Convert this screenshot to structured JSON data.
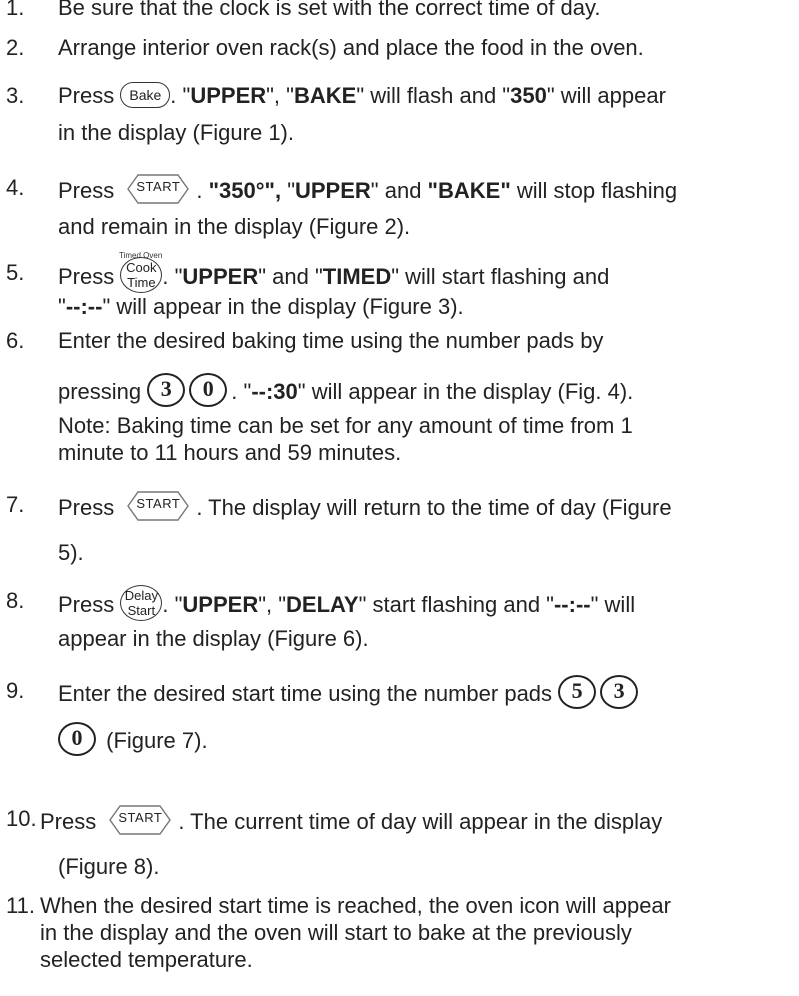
{
  "steps": {
    "s1": {
      "num": "1.",
      "text": "Be sure that the clock is set with the correct time of day."
    },
    "s2": {
      "num": "2.",
      "text": "Arrange interior oven rack(s) and place the food in the oven."
    },
    "s3": {
      "num": "3.",
      "t1": "Press ",
      "btn": "Bake",
      "t2": ". \"",
      "b1": "UPPER",
      "t3": "\", \"",
      "b2": "BAKE",
      "t4": "\" will flash and \"",
      "b3": "350",
      "t5": "\" will appear",
      "line2": "in the display (Figure 1)."
    },
    "s4": {
      "num": "4.",
      "t1": "Press ",
      "btn": "START",
      "t2": ". ",
      "b1": "\"350°\",",
      "t3": " \"",
      "b2": "UPPER",
      "t4": "\" and ",
      "b3": "\"BAKE\"",
      "t5": " will stop flashing",
      "line2": "and remain in the display (Figure 2)."
    },
    "s5": {
      "num": "5.",
      "label": "Timed Oven",
      "t1": "Press ",
      "btn_l1": "Cook",
      "btn_l2": "Time",
      "t2": ". \"",
      "b1": "UPPER",
      "t3": "\" and \"",
      "b2": "TIMED",
      "t4": "\" will start flashing and",
      "line2_a": "\"",
      "line2_b": "--:--",
      "line2_c": "\" will appear in the display (Figure 3)."
    },
    "s6": {
      "num": "6.",
      "line1": "Enter the desired baking time using the number pads by",
      "t1": "pressing ",
      "p1": "3",
      "p2": "0",
      "t2": ". \"",
      "b1": "--:30",
      "t3": "\" will appear in the display (Fig. 4).",
      "note1": "Note: Baking time can be set for any amount of time from 1",
      "note2": "minute to 11 hours and 59 minutes."
    },
    "s7": {
      "num": "7.",
      "t1": "Press ",
      "btn": "START",
      "t2": ". The display will return to the time of day (Figure",
      "line2": "5)."
    },
    "s8": {
      "num": "8.",
      "t1": "Press ",
      "btn_l1": "Delay",
      "btn_l2": "Start",
      "t2": ". \"",
      "b1": "UPPER",
      "t3": "\", \"",
      "b2": "DELAY",
      "t4": "\" start flashing and \"",
      "b3": "--:--",
      "t5": "\" will",
      "line2": "appear in the display (Figure 6)."
    },
    "s9": {
      "num": "9.",
      "t1": "Enter the desired start time using the number pads ",
      "p1": "5",
      "p2": "3",
      "p3": "0",
      "t2": " (Figure 7)."
    },
    "s10": {
      "num": "10.",
      "t1": "Press ",
      "btn": "START",
      "t2": ". The current time of day will appear in the display",
      "line2": "(Figure 8)."
    },
    "s11": {
      "num": "11.",
      "l1": "When the desired start time is reached, the oven icon will appear",
      "l2": "in the display and the oven will start to bake at the previously",
      "l3": "selected temperature."
    }
  }
}
